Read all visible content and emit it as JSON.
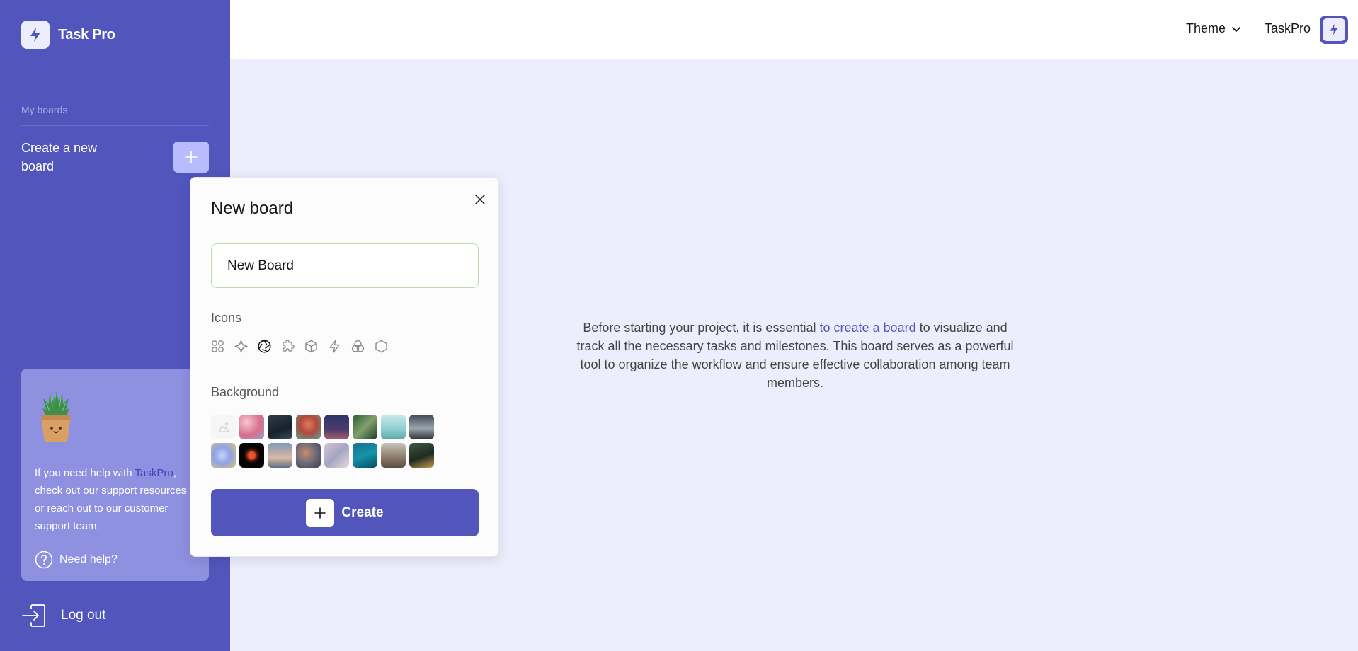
{
  "app": {
    "name": "Task Pro"
  },
  "sidebar": {
    "section_title": "My boards",
    "create_board_label": "Create a new board",
    "help": {
      "text_before": "If you need help with ",
      "highlight": "TaskPro",
      "text_after": ", check out our support resources or reach out to our customer support team.",
      "need_help_label": "Need help?"
    },
    "logout_label": "Log out"
  },
  "header": {
    "theme_label": "Theme",
    "username": "TaskPro"
  },
  "main": {
    "text_before": "Before starting your project, it is essential ",
    "link_text": "to create a board",
    "text_after": " to visualize and track all the necessary tasks and milestones. This board serves as a powerful tool to organize the workflow and ensure effective collaboration among team members."
  },
  "modal": {
    "title": "New board",
    "input_value": "New Board",
    "icons_label": "Icons",
    "icons": [
      "four-circles-icon",
      "sparkle-icon",
      "aperture-icon",
      "puzzle-icon",
      "cube-icon",
      "lightning-icon",
      "color-circles-icon",
      "hexagon-icon"
    ],
    "selected_icon_index": 2,
    "background_label": "Background",
    "backgrounds": [
      "none",
      "pink-blossom",
      "dark-night-sky",
      "red-tree",
      "night-moon",
      "green-leaves",
      "sea-coast",
      "rainy-road",
      "blue-bubble",
      "red-moon",
      "sunset-balloon",
      "hot-air-balloons",
      "pastel-sky",
      "ocean-boat",
      "canyon",
      "dark-forest-sky"
    ],
    "create_label": "Create"
  },
  "colors": {
    "accent": "#5255BC",
    "sidebar_bg": "#5255BC",
    "page_bg": "#ECEDFD",
    "help_card_bg": "#8E90E0"
  }
}
